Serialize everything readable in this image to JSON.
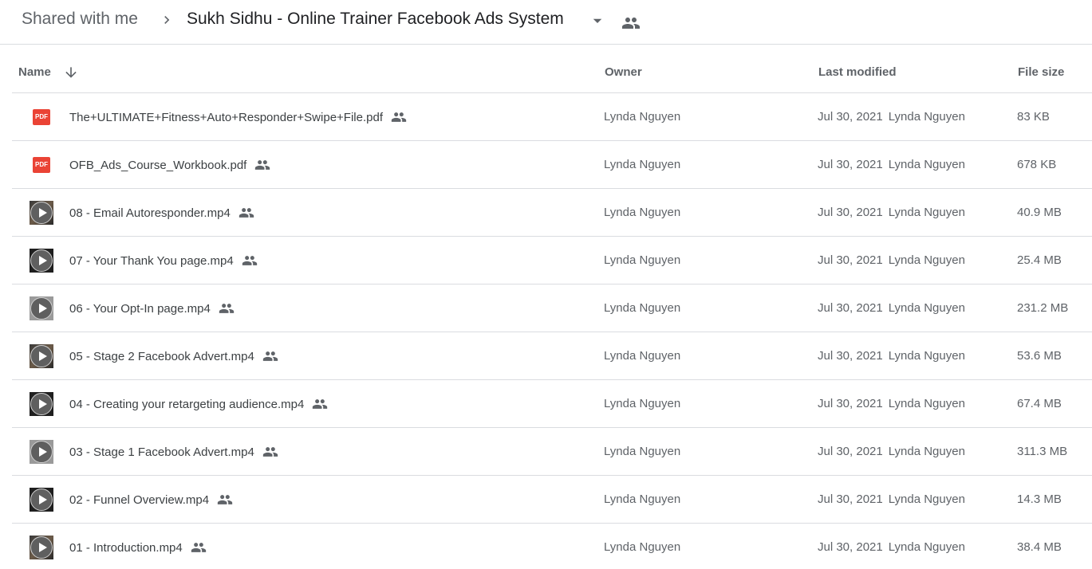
{
  "breadcrumb": {
    "root": "Shared with me",
    "current": "Sukh Sidhu - Online Trainer Facebook Ads System"
  },
  "columns": {
    "name": "Name",
    "owner": "Owner",
    "last_modified": "Last modified",
    "file_size": "File size"
  },
  "files": [
    {
      "name": "The+ULTIMATE+Fitness+Auto+Responder+Swipe+File.pdf",
      "type": "pdf",
      "owner": "Lynda Nguyen",
      "modified_date": "Jul 30, 2021",
      "modified_by": "Lynda Nguyen",
      "size": "83 KB"
    },
    {
      "name": "OFB_Ads_Course_Workbook.pdf",
      "type": "pdf",
      "owner": "Lynda Nguyen",
      "modified_date": "Jul 30, 2021",
      "modified_by": "Lynda Nguyen",
      "size": "678 KB"
    },
    {
      "name": "08 - Email Autoresponder.mp4",
      "type": "video",
      "owner": "Lynda Nguyen",
      "modified_date": "Jul 30, 2021",
      "modified_by": "Lynda Nguyen",
      "size": "40.9 MB"
    },
    {
      "name": "07 - Your Thank You page.mp4",
      "type": "video",
      "owner": "Lynda Nguyen",
      "modified_date": "Jul 30, 2021",
      "modified_by": "Lynda Nguyen",
      "size": "25.4 MB"
    },
    {
      "name": "06 - Your Opt-In page.mp4",
      "type": "video",
      "owner": "Lynda Nguyen",
      "modified_date": "Jul 30, 2021",
      "modified_by": "Lynda Nguyen",
      "size": "231.2 MB"
    },
    {
      "name": "05 - Stage 2 Facebook Advert.mp4",
      "type": "video",
      "owner": "Lynda Nguyen",
      "modified_date": "Jul 30, 2021",
      "modified_by": "Lynda Nguyen",
      "size": "53.6 MB"
    },
    {
      "name": "04 - Creating your retargeting audience.mp4",
      "type": "video",
      "owner": "Lynda Nguyen",
      "modified_date": "Jul 30, 2021",
      "modified_by": "Lynda Nguyen",
      "size": "67.4 MB"
    },
    {
      "name": "03 - Stage 1 Facebook Advert.mp4",
      "type": "video",
      "owner": "Lynda Nguyen",
      "modified_date": "Jul 30, 2021",
      "modified_by": "Lynda Nguyen",
      "size": "311.3 MB"
    },
    {
      "name": "02 - Funnel Overview.mp4",
      "type": "video",
      "owner": "Lynda Nguyen",
      "modified_date": "Jul 30, 2021",
      "modified_by": "Lynda Nguyen",
      "size": "14.3 MB"
    },
    {
      "name": "01 - Introduction.mp4",
      "type": "video",
      "owner": "Lynda Nguyen",
      "modified_date": "Jul 30, 2021",
      "modified_by": "Lynda Nguyen",
      "size": "38.4 MB"
    }
  ],
  "icons": {
    "pdf_label": "PDF",
    "shared": "people-icon",
    "sort": "arrow-down-icon",
    "separator": "chevron-right-icon",
    "caret": "caret-down-icon"
  },
  "colors": {
    "pdf_red": "#ea4335",
    "divider": "#dadce0",
    "text_primary": "#202124",
    "text_secondary": "#5f6368"
  }
}
